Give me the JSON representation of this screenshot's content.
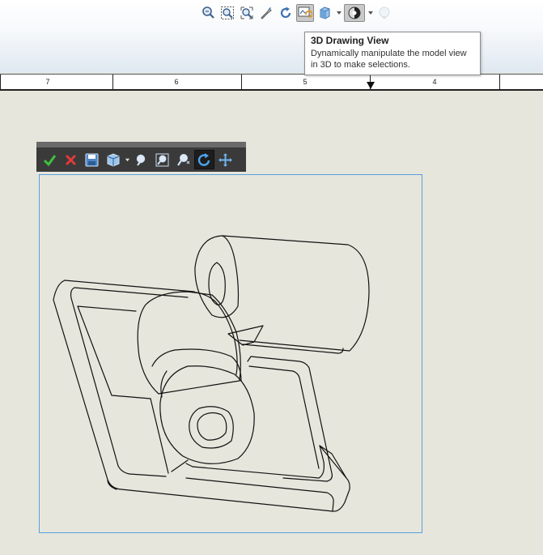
{
  "heads_up_toolbar": {
    "items": [
      {
        "icon": "zoom-to-fit-icon"
      },
      {
        "icon": "zoom-to-area-icon"
      },
      {
        "icon": "zoom-to-selection-icon"
      },
      {
        "icon": "pan-icon"
      },
      {
        "icon": "rotate-view-icon"
      },
      {
        "icon": "3d-drawing-view-icon",
        "active": true
      },
      {
        "icon": "view-orientation-icon"
      },
      {
        "icon": "display-style-icon"
      },
      {
        "icon": "hide-show-items-icon"
      }
    ]
  },
  "tooltip": {
    "title": "3D Drawing View",
    "body": "Dynamically manipulate the model view in 3D to make selections."
  },
  "ruler": {
    "labels": [
      "7",
      "6",
      "5",
      "4"
    ]
  },
  "view_toolbar": {
    "items": [
      {
        "icon": "check-icon"
      },
      {
        "icon": "close-icon"
      },
      {
        "icon": "save-view-icon"
      },
      {
        "icon": "view-orientation-icon"
      },
      {
        "icon": "zoom-to-area-icon"
      },
      {
        "icon": "zoom-to-fit-icon"
      },
      {
        "icon": "zoom-in-out-icon"
      },
      {
        "icon": "rotate-icon",
        "active": true
      },
      {
        "icon": "pan-icon"
      }
    ]
  },
  "colors": {
    "background": "#e6e6dc",
    "view_border": "#5a9ee0",
    "toolbar_dark": "#3a3a3a",
    "line": "#111111"
  }
}
